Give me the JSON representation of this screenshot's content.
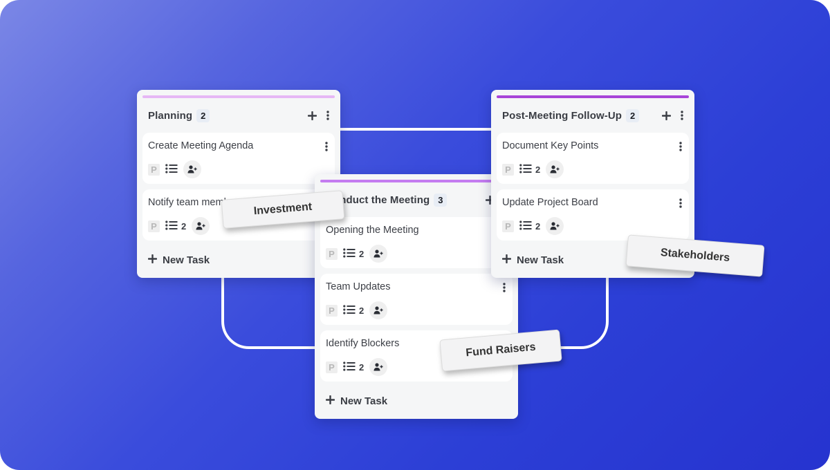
{
  "columns": [
    {
      "id": "planning",
      "title": "Planning",
      "count": "2",
      "accent": "#e6b7f5",
      "tasks": [
        {
          "title": "Create Meeting Agenda",
          "priority": "P",
          "subtasks": ""
        },
        {
          "title": "Notify team members",
          "priority": "P",
          "subtasks": "2"
        }
      ],
      "new_task_label": "New Task"
    },
    {
      "id": "conduct",
      "title": "Conduct the Meeting",
      "count": "3",
      "accent": "#c47cf0",
      "tasks": [
        {
          "title": "Opening the Meeting",
          "priority": "P",
          "subtasks": "2"
        },
        {
          "title": "Team Updates",
          "priority": "P",
          "subtasks": "2"
        },
        {
          "title": "Identify Blockers",
          "priority": "P",
          "subtasks": "2"
        }
      ],
      "new_task_label": "New Task"
    },
    {
      "id": "followup",
      "title": "Post-Meeting Follow-Up",
      "count": "2",
      "accent": "#a845d8",
      "tasks": [
        {
          "title": "Document Key Points",
          "priority": "P",
          "subtasks": "2"
        },
        {
          "title": "Update Project Board",
          "priority": "P",
          "subtasks": "2"
        }
      ],
      "new_task_label": "New Task"
    }
  ],
  "tags": {
    "investment": "Investment",
    "stakeholders": "Stakeholders",
    "fund_raisers": "Fund Raisers"
  },
  "icons": {
    "add": "plus-icon",
    "menu": "more-vertical-icon",
    "subtasks": "list-icon",
    "assign": "add-user-icon"
  },
  "colors": {
    "background_start": "#7b87e6",
    "background_end": "#2633cf",
    "column_bg": "#f5f6f7",
    "card_bg": "#ffffff"
  }
}
